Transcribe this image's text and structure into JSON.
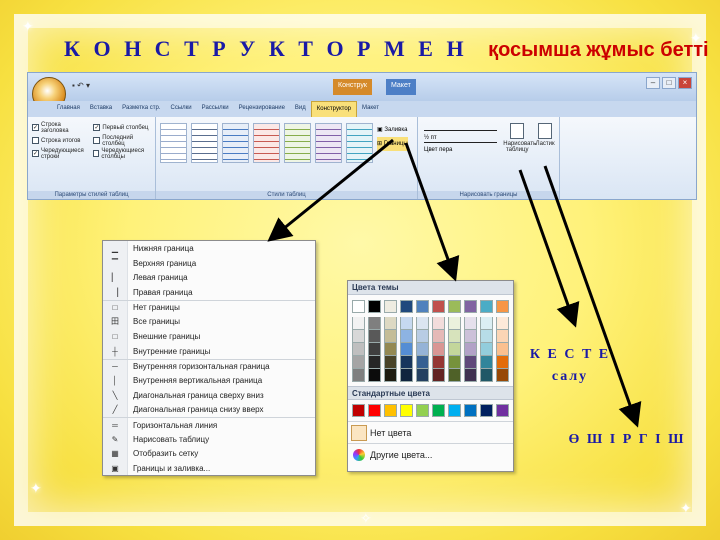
{
  "heading": {
    "main": "К О Н С Т Р У К Т О Р М Е Н",
    "sub": "қосымша жұмыс бетті"
  },
  "ribbon": {
    "contextual_tabs": [
      "Конструк",
      "Макет"
    ],
    "tabs": [
      "Главная",
      "Вставка",
      "Разметка стр.",
      "Ссылки",
      "Рассылки",
      "Рецензирование",
      "Вид",
      "Конструктор",
      "Макет"
    ],
    "active_tab": "Конструктор",
    "group1": {
      "label": "Параметры стилей таблиц",
      "checks": [
        "Строка заголовка",
        "Строка итогов",
        "Чередующиеся строки",
        "Первый столбец",
        "Последний столбец",
        "Чередующиеся столбцы"
      ]
    },
    "group2": {
      "label": "Стили таблиц",
      "shading": "Заливка",
      "borders": "Границы"
    },
    "group3": {
      "label": "Нарисовать границы",
      "pen_weight": "½ пт",
      "pen_color": "Цвет пера"
    },
    "group3_buttons": [
      "Нарисовать таблицу",
      "Ластик"
    ]
  },
  "border_menu": {
    "items": [
      {
        "icon": "▁",
        "label": "Нижняя граница"
      },
      {
        "icon": "▔",
        "label": "Верхняя граница"
      },
      {
        "icon": "▏",
        "label": "Левая граница"
      },
      {
        "icon": "▕",
        "label": "Правая граница"
      },
      {
        "icon": "□",
        "label": "Нет границы",
        "sep": true
      },
      {
        "icon": "田",
        "label": "Все границы"
      },
      {
        "icon": "□",
        "label": "Внешние границы"
      },
      {
        "icon": "┼",
        "label": "Внутренние границы"
      },
      {
        "icon": "─",
        "label": "Внутренняя горизонтальная граница",
        "sep": true
      },
      {
        "icon": "│",
        "label": "Внутренняя вертикальная граница"
      },
      {
        "icon": "╲",
        "label": "Диагональная граница сверху вниз"
      },
      {
        "icon": "╱",
        "label": "Диагональная граница снизу вверх"
      },
      {
        "icon": "═",
        "label": "Горизонтальная линия",
        "sep": true
      },
      {
        "icon": "✎",
        "label": "Нарисовать таблицу"
      },
      {
        "icon": "▦",
        "label": "Отобразить сетку"
      },
      {
        "icon": "▣",
        "label": "Границы и заливка..."
      }
    ]
  },
  "palette": {
    "theme_header": "Цвета темы",
    "theme_colors": [
      "#ffffff",
      "#000000",
      "#eeece1",
      "#1f497d",
      "#4f81bd",
      "#c0504d",
      "#9bbb59",
      "#8064a2",
      "#4bacc6",
      "#f79646"
    ],
    "shades": [
      [
        "#f2f2f2",
        "#d8d8d8",
        "#bfbfbf",
        "#a5a5a5",
        "#7f7f7f"
      ],
      [
        "#7f7f7f",
        "#595959",
        "#3f3f3f",
        "#262626",
        "#0c0c0c"
      ],
      [
        "#ddd9c3",
        "#c4bd97",
        "#938953",
        "#494429",
        "#1d1b10"
      ],
      [
        "#c6d9f0",
        "#8db3e2",
        "#548dd4",
        "#17365d",
        "#0f243e"
      ],
      [
        "#dbe5f1",
        "#b8cce4",
        "#95b3d7",
        "#366092",
        "#244061"
      ],
      [
        "#f2dcdb",
        "#e5b9b7",
        "#d99694",
        "#953734",
        "#632423"
      ],
      [
        "#ebf1dd",
        "#d7e3bc",
        "#c3d69b",
        "#76923c",
        "#4f6128"
      ],
      [
        "#e5e0ec",
        "#ccc1d9",
        "#b2a2c7",
        "#5f497a",
        "#3f3151"
      ],
      [
        "#dbeef3",
        "#b7dde8",
        "#92cddc",
        "#31859b",
        "#205867"
      ],
      [
        "#fdeada",
        "#fbd5b5",
        "#fac08f",
        "#e36c09",
        "#974806"
      ]
    ],
    "standard_header": "Стандартные цвета",
    "standard_colors": [
      "#c00000",
      "#ff0000",
      "#ffc000",
      "#ffff00",
      "#92d050",
      "#00b050",
      "#00b0f0",
      "#0070c0",
      "#002060",
      "#7030a0"
    ],
    "no_color": "Нет цвета",
    "more_colors": "Другие цвета..."
  },
  "notes": {
    "table_draw": [
      "К Е С Т Е",
      "салу"
    ],
    "eraser": "Ө Ш І Р Г І Ш"
  },
  "colors": {
    "heading_main": "#1a1aa6",
    "heading_sub": "#cc0000",
    "arrow": "#000000"
  }
}
